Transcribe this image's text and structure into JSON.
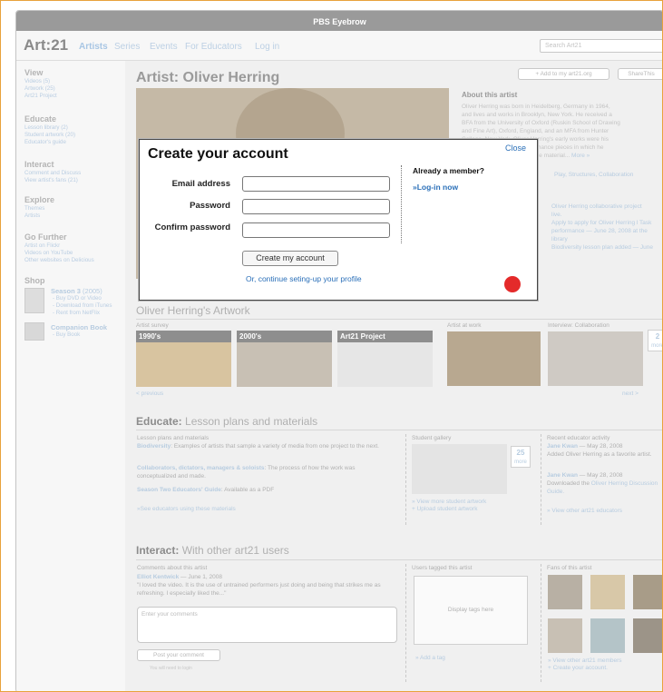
{
  "eyebrow": "PBS Eyebrow",
  "header": {
    "logo": "Art:21",
    "nav": [
      "Artists",
      "Series",
      "Events",
      "For Educators",
      "Log in"
    ],
    "search_placeholder": "Search Art21"
  },
  "sidebar": {
    "view": {
      "title": "View",
      "items": [
        "Videos (5)",
        "Artwork (25)",
        "Art21 Project"
      ]
    },
    "educate": {
      "title": "Educate",
      "items": [
        "Lesson library (2)",
        "Student artwork (20)",
        "Educator's guide"
      ]
    },
    "interact": {
      "title": "Interact",
      "items": [
        "Comment and Discuss",
        "View artist's fans (21)"
      ]
    },
    "explore": {
      "title": "Explore",
      "items": [
        "Themes",
        "Artists"
      ]
    },
    "further": {
      "title": "Go Further",
      "items": [
        "Artist on Flickr",
        "Videos on YouTube",
        "Other websites on Delicious"
      ]
    },
    "shop": {
      "title": "Shop",
      "season": "Season 3",
      "season_year": "(2005)",
      "season_links": [
        "- Buy DVD or Video",
        "- Download from iTunes",
        "- Rent from NetFlix"
      ],
      "companion": "Companion Book",
      "companion_link": "- Buy Book"
    }
  },
  "artist": {
    "title": "Artist: Oliver Herring",
    "add_button": "+ Add to my art21.org",
    "share_button": "ShareThis",
    "about_title": "About this artist",
    "about_lines": [
      "Oliver Herring was born in Heidelberg, Germany in 1964,",
      "and lives and works in Brooklyn, New York. He received a",
      "BFA from the University of Oxford (Ruskin School of Drawing",
      "and Fine Art), Oxford, England, and an MFA from Hunter",
      "College, New York. Oliver Herring's early works were his",
      "knitted sculptures and performance pieces in which he",
      "created poignant and reflective material...",
      "More »"
    ],
    "themes": "Play, Structures, Collaboration",
    "news_lines": [
      "Oliver Herring collaborative project",
      "live.",
      "Apply to apply for Oliver Herring l Task",
      "performance — June 28, 2008 at the",
      "library",
      "Biodiversity lesson plan added  — June"
    ]
  },
  "artwork": {
    "title": "Oliver Herring's Artwork",
    "survey_label": "Artist survey",
    "thumbs": [
      "1990's",
      "2000's",
      "Art21 Project"
    ],
    "at_work": "Artist at work",
    "interview": "Interview: Collaboration",
    "count": "2",
    "count_more": "more",
    "prev": "< previous",
    "next": "next >"
  },
  "educate": {
    "heading": "Educate:",
    "subheading": "Lesson plans and materials",
    "col_title": "Lesson plans and materials",
    "plans": [
      {
        "title": "Biodiversity",
        "text": ": Examples of artists that sample a variety of media from one project to the next."
      },
      {
        "title": "Collaborators, dictators, managers & soloists",
        "text": ": The process of how the work was conceptualized and made."
      },
      {
        "title": "Season Two Educators' Guide",
        "text": ": Available as a PDF"
      }
    ],
    "see_educators": "»See educators using these materials",
    "gallery_title": "Student gallery",
    "gallery_count": "25",
    "gallery_more": "more",
    "gallery_links": [
      "» View more student artwork",
      "+ Upload student artwork"
    ],
    "activity_title": "Recent educator activity",
    "activity": [
      {
        "name": "Jane Kwan",
        "date": " — May 28, 2008",
        "text": "Added Oliver Herring as a favorite artist."
      },
      {
        "name": "Jane Kwan",
        "date": " — May 28, 2008",
        "text": "Downloaded the ",
        "link": "Oliver Herring Discussion Guide."
      }
    ],
    "view_educators": "» View other art21 educators"
  },
  "interact": {
    "heading": "Interact:",
    "subheading": "With other art21 users",
    "comments_title": "Comments about this artist",
    "comment_author": "Elliot Kentwick",
    "comment_date": " — June 1, 2008",
    "comment_text": "\"I loved the video. It is the use of untrained performers just doing and being that strikes me as refreshing. I especially liked the...\"",
    "comment_placeholder": "Enter your comments",
    "post_button": "Post your comment",
    "login_note": "You will need to login",
    "tags_title": "Users tagged this artist",
    "tags_placeholder": "Display tags here",
    "add_tag": "» Add a tag",
    "fans_title": "Fans of this artist",
    "fans_links": [
      "» View other art21 members",
      "+ Create your account."
    ]
  },
  "modal": {
    "title": "Create your account",
    "close": "Close",
    "email_label": "Email address",
    "password_label": "Password",
    "confirm_label": "Confirm password",
    "submit": "Create my account",
    "continue_link": "Or, continue seting-up your profile",
    "member_title": "Already a member?",
    "login_link": "Log-in now",
    "login_arrow": "»"
  }
}
